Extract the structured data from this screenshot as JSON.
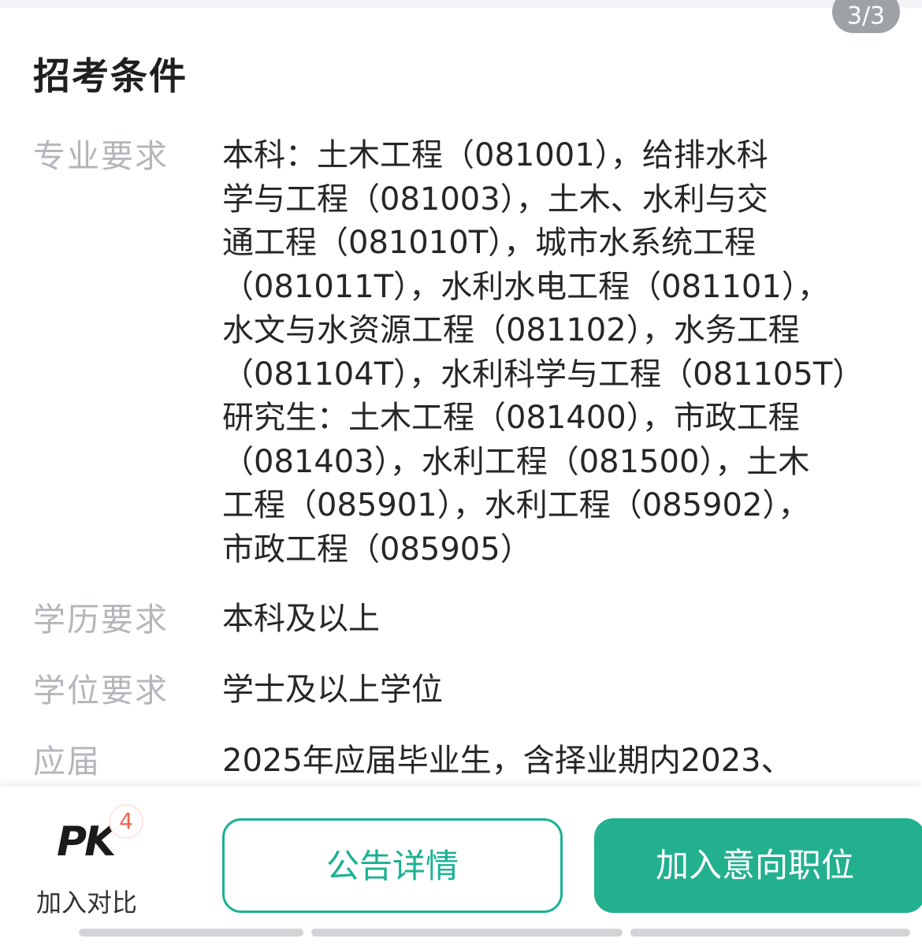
{
  "page_indicator": "3/3",
  "section_title": "招考条件",
  "rows": [
    {
      "label": "专业要求",
      "lines": [
        "本科：土木工程（081001），给排水科",
        "学与工程（081003），土木、水利与交",
        "通工程（081010T），城市水系统工程",
        "（081011T），水利水电工程（081101），",
        "水文与水资源工程（081102），水务工程",
        "（081104T），水利科学与工程（081105T）",
        "研究生：土木工程（081400），市政工程",
        "（081403），水利工程（081500），土木",
        "工程（085901），水利工程（085902），",
        "市政工程（085905）"
      ]
    },
    {
      "label": "学历要求",
      "lines": [
        "本科及以上"
      ]
    },
    {
      "label": "学位要求",
      "lines": [
        "学士及以上学位"
      ]
    },
    {
      "label": "应届",
      "lines": [
        "2025年应届毕业生，含择业期内2023、"
      ]
    }
  ],
  "bottom_bar": {
    "pk_logo": "PK",
    "pk_badge_count": "4",
    "pk_label": "加入对比",
    "detail_button": "公告详情",
    "join_button": "加入意向职位"
  },
  "colors": {
    "accent": "#1ab191",
    "accent_fill": "#22b08f",
    "label_gray": "#b3b6bb",
    "badge_red": "#f0624f"
  }
}
